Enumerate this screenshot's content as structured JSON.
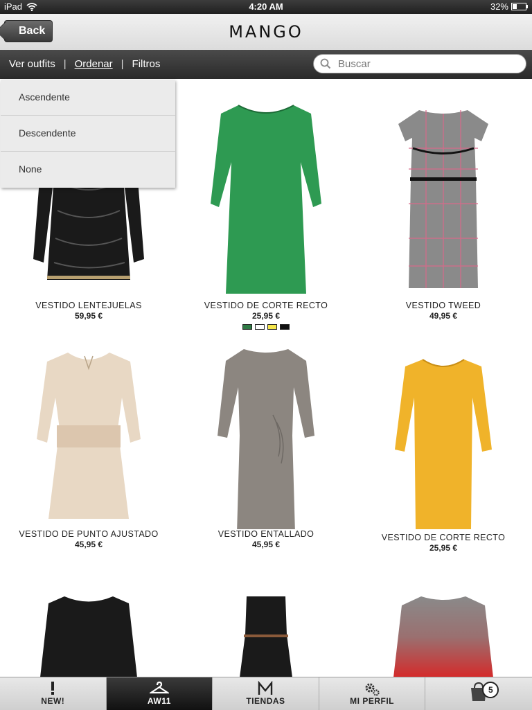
{
  "status_bar": {
    "device": "iPad",
    "time": "4:20 AM",
    "battery": "32%",
    "battery_level": 0.32
  },
  "header": {
    "back_label": "Back",
    "logo": "MANGO"
  },
  "toolbar": {
    "outfits": "Ver outfits",
    "sort": "Ordenar",
    "filters": "Filtros",
    "separator": "|",
    "search_placeholder": "Buscar"
  },
  "sort_menu": {
    "options": [
      "Ascendente",
      "Descendente",
      "None"
    ]
  },
  "products": [
    {
      "name": "VESTIDO LENTEJUELAS",
      "price": "59,95 €"
    },
    {
      "name": "VESTIDO DE CORTE RECTO",
      "price": "25,95 €",
      "swatches": [
        "#2f7a45",
        "#ffffff",
        "#f5e64a",
        "#111111"
      ]
    },
    {
      "name": "VESTIDO TWEED",
      "price": "49,95 €"
    },
    {
      "name": "VESTIDO DE PUNTO AJUSTADO",
      "price": "45,95 €"
    },
    {
      "name": "VESTIDO ENTALLADO",
      "price": "45,95 €"
    },
    {
      "name": "VESTIDO DE CORTE RECTO",
      "price": "25,95 €"
    },
    {
      "name": "",
      "price": ""
    },
    {
      "name": "",
      "price": ""
    },
    {
      "name": "",
      "price": ""
    }
  ],
  "tabs": [
    {
      "label": "NEW!",
      "icon": "exclamation-icon"
    },
    {
      "label": "AW11",
      "icon": "hanger-icon",
      "selected": true
    },
    {
      "label": "TIENDAS",
      "icon": "mango-m-icon"
    },
    {
      "label": "MI PERFIL",
      "icon": "gears-icon"
    },
    {
      "label": "",
      "icon": "shopping-bag-icon",
      "badge": "5"
    }
  ],
  "colors": {
    "dress_black": "#1a1a1a",
    "dress_green": "#2e9a52",
    "dress_tweed": "#8a8a8a",
    "dress_beige": "#e8d8c4",
    "dress_grey": "#8c8680",
    "dress_yellow": "#f0b32a",
    "dress_red": "#d42a2a"
  }
}
